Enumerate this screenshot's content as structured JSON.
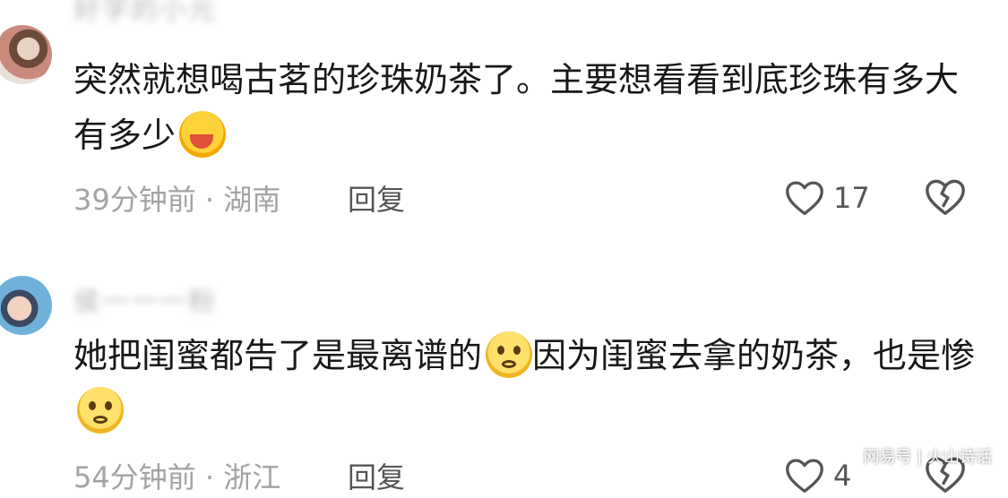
{
  "comments": [
    {
      "username": "好学的小元",
      "text": "突然就想喝古茗的珍珠奶茶了。主要想看看到底珍珠有多大有多少",
      "emoji": "laugh-cry-emoji",
      "time_location": "39分钟前 · 湖南",
      "reply_label": "回复",
      "like_count": "17"
    },
    {
      "username": "侯一一一粉",
      "text_part1": "她把闺蜜都告了是最离谱的",
      "emoji1": "pout-emoji",
      "text_part2": "因为闺蜜去拿的奶茶，也是惨",
      "emoji2": "pout-emoji",
      "time_location": "54分钟前 · 浙江",
      "reply_label": "回复",
      "like_count": "4"
    }
  ],
  "watermark": "网易号 | 火山诗话",
  "colors": {
    "text": "#181818",
    "meta": "#a3a3a3",
    "action": "#555555"
  }
}
